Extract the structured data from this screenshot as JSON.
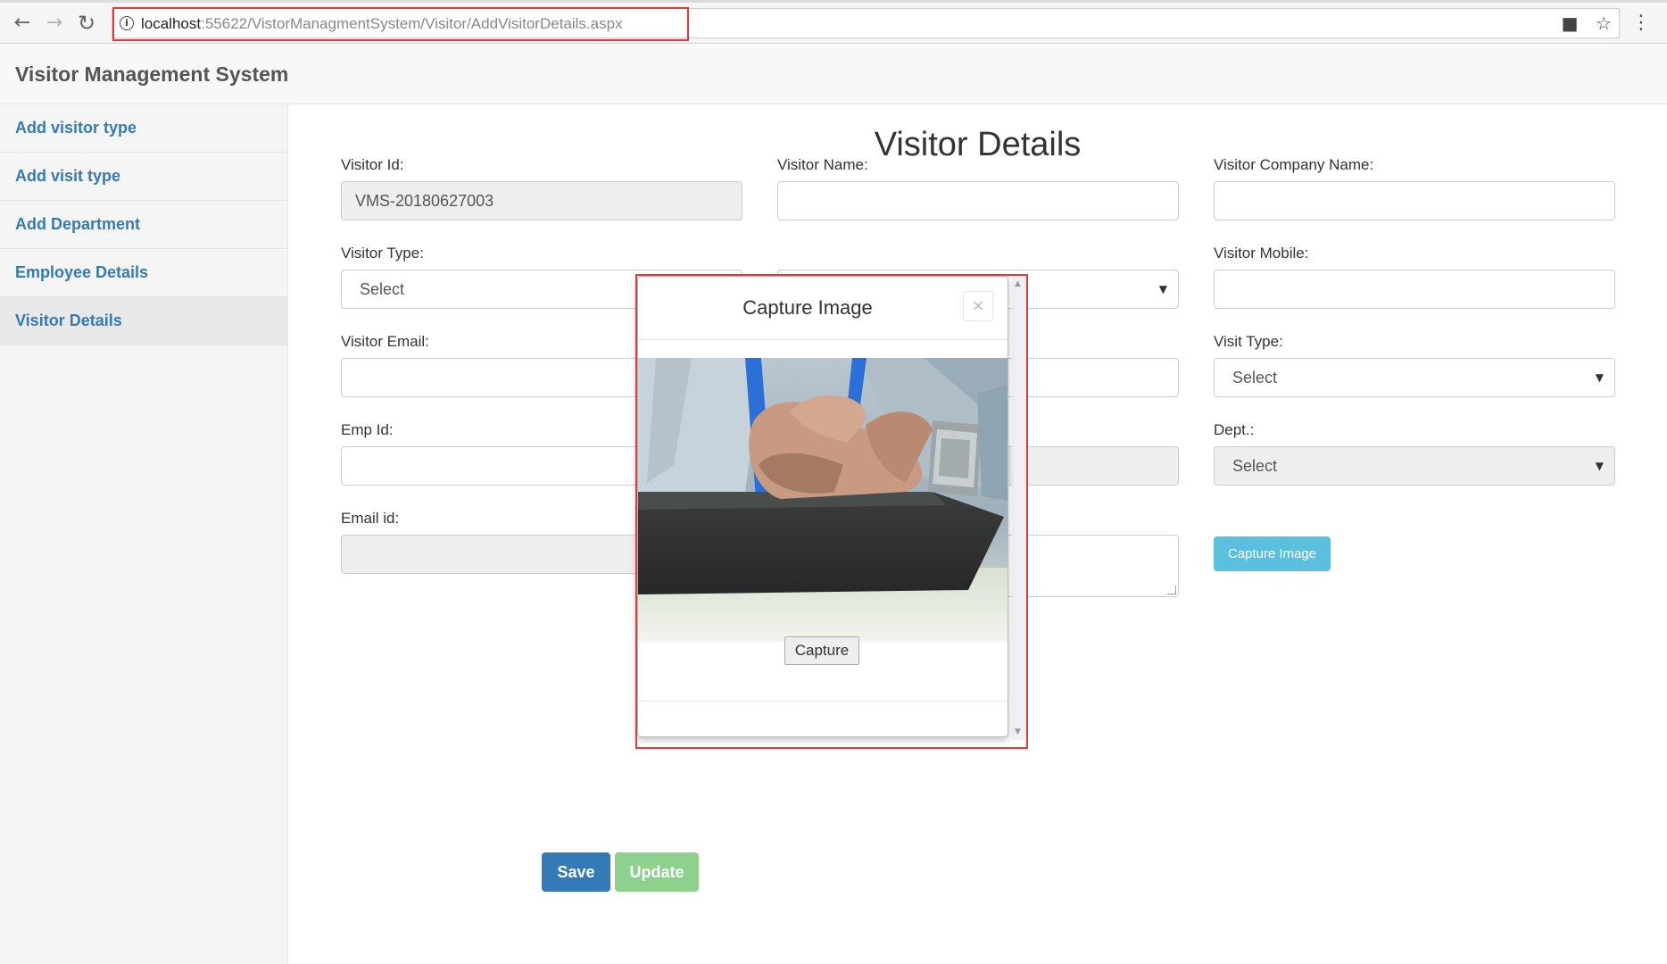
{
  "browser": {
    "url_host": "localhost",
    "url_rest": ":55622/VistorManagmentSystem/Visitor/AddVisitorDetails.aspx"
  },
  "app": {
    "brand": "Visitor Management System"
  },
  "sidebar": {
    "items": [
      {
        "label": "Add visitor type"
      },
      {
        "label": "Add visit type"
      },
      {
        "label": "Add Department"
      },
      {
        "label": "Employee Details"
      },
      {
        "label": "Visitor Details"
      }
    ]
  },
  "page": {
    "title": "Visitor Details"
  },
  "form": {
    "visitor_id": {
      "label": "Visitor Id:",
      "value": "VMS-20180627003"
    },
    "visitor_name": {
      "label": "Visitor Name:",
      "value": ""
    },
    "visitor_company": {
      "label": "Visitor Company Name:",
      "value": ""
    },
    "visitor_type": {
      "label": "Visitor Type:",
      "value": "Select"
    },
    "visitor_mobile": {
      "label": "Visitor Mobile:",
      "value": ""
    },
    "visitor_email": {
      "label": "Visitor Email:",
      "value": ""
    },
    "visit_type": {
      "label": "Visit Type:",
      "value": "Select"
    },
    "emp_id": {
      "label": "Emp Id:",
      "value": ""
    },
    "dept": {
      "label": "Dept.:",
      "value": "Select"
    },
    "email_id": {
      "label": "Email id:",
      "value": ""
    },
    "capture_image_button": "Capture Image",
    "save_button": "Save",
    "update_button": "Update"
  },
  "modal": {
    "title": "Capture Image",
    "close": "×",
    "capture_button": "Capture"
  },
  "colors": {
    "link": "#337ab7",
    "primary": "#337ab7",
    "info": "#5bc0de",
    "success_disabled": "#8ed08e",
    "highlight": "#e53935"
  }
}
